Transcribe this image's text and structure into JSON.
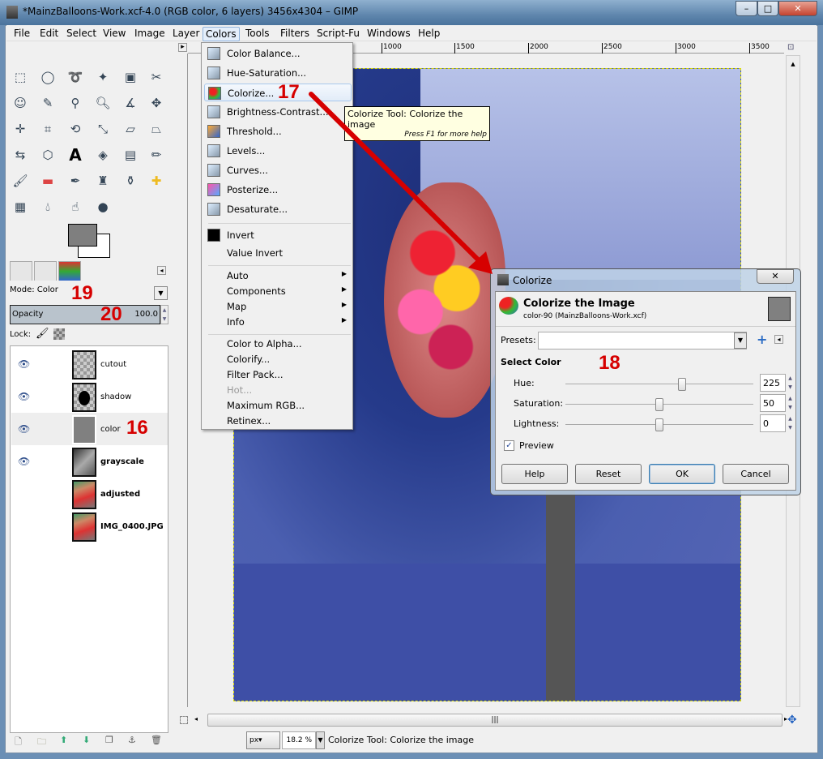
{
  "window": {
    "title": "*MainzBalloons-Work.xcf-4.0 (RGB color, 6 layers) 3456x4304 – GIMP",
    "minimize": "–",
    "maximize": "□",
    "close": "✕"
  },
  "menubar": [
    "File",
    "Edit",
    "Select",
    "View",
    "Image",
    "Layer",
    "Colors",
    "Tools",
    "Filters",
    "Script-Fu",
    "Windows",
    "Help"
  ],
  "colors_menu": {
    "group1": [
      "Color Balance...",
      "Hue-Saturation...",
      "Colorize...",
      "Brightness-Contrast...",
      "Threshold...",
      "Levels...",
      "Curves...",
      "Posterize...",
      "Desaturate..."
    ],
    "group2": [
      "Invert",
      "Value Invert"
    ],
    "group3": [
      "Auto",
      "Components",
      "Map",
      "Info"
    ],
    "group4": [
      "Color to Alpha...",
      "Colorify...",
      "Filter Pack...",
      "Hot...",
      "Maximum RGB...",
      "Retinex..."
    ],
    "highlighted": "Colorize...",
    "disabled": [
      "Hot..."
    ]
  },
  "tooltip": {
    "text": "Colorize Tool: Colorize the image",
    "hint": "Press F1 for more help"
  },
  "ruler": [
    "1000",
    "1500",
    "2000",
    "2500",
    "3000",
    "3500"
  ],
  "layers_panel": {
    "mode": "Mode: Color",
    "opacity_label": "Opacity",
    "opacity_value": "100.0",
    "lock_label": "Lock:",
    "layers": [
      {
        "name": "cutout",
        "visible": true,
        "bold": false
      },
      {
        "name": "shadow",
        "visible": true,
        "bold": false
      },
      {
        "name": "color",
        "visible": true,
        "bold": false,
        "selected": true
      },
      {
        "name": "grayscale",
        "visible": true,
        "bold": true
      },
      {
        "name": "adjusted",
        "visible": false,
        "bold": true
      },
      {
        "name": "IMG_0400.JPG",
        "visible": false,
        "bold": true
      }
    ]
  },
  "annotations": {
    "a16": "16",
    "a17": "17",
    "a18": "18",
    "a19": "19",
    "a20": "20"
  },
  "dialog": {
    "title": "Colorize",
    "heading": "Colorize the Image",
    "subheading": "color-90 (MainzBalloons-Work.xcf)",
    "presets_label": "Presets:",
    "presets_value": "",
    "section": "Select Color",
    "hue": {
      "label": "Hue:",
      "value": "225",
      "fraction": 0.625
    },
    "saturation": {
      "label": "Saturation:",
      "value": "50",
      "fraction": 0.5
    },
    "lightness": {
      "label": "Lightness:",
      "value": "0",
      "fraction": 0.5
    },
    "preview_label": "Preview",
    "preview_checked": true,
    "buttons": [
      "Help",
      "Reset",
      "OK",
      "Cancel"
    ]
  },
  "statusbar": {
    "unit": "px",
    "zoom": "18.2 %",
    "message": "Colorize Tool: Colorize the image"
  },
  "accent": {
    "annotation": "#d60000",
    "selection": "#e4eefa"
  }
}
